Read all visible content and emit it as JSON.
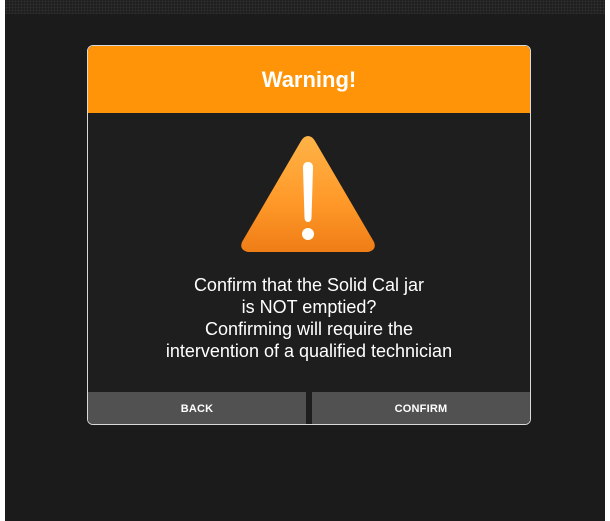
{
  "dialog": {
    "title": "Warning!",
    "icon": "warning-triangle-icon",
    "message_lines": [
      "Confirm that the Solid Cal jar",
      "is NOT emptied?",
      "Confirming will require the",
      "intervention of a qualified technician"
    ],
    "buttons": {
      "back_label": "BACK",
      "confirm_label": "CONFIRM"
    }
  },
  "colors": {
    "header": "#ff9408",
    "background": "#1b1b1b",
    "button": "#515151"
  }
}
